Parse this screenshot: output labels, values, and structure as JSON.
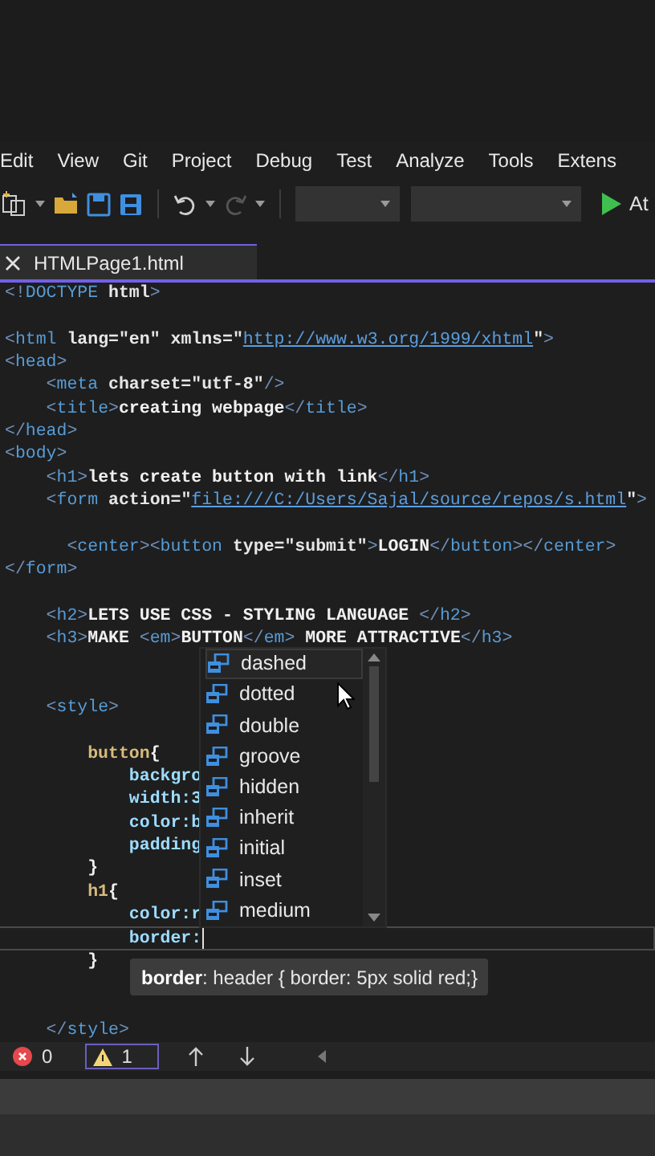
{
  "menu": [
    "Edit",
    "View",
    "Git",
    "Project",
    "Debug",
    "Test",
    "Analyze",
    "Tools",
    "Extens"
  ],
  "toolbar": {
    "run_label": "At"
  },
  "tabs": [
    {
      "label": "HTMLPage1.html",
      "selected": true
    }
  ],
  "editor": {
    "lines": [
      {
        "current": false,
        "segments": [
          {
            "kind": "punct",
            "text": "<!"
          },
          {
            "kind": "tag",
            "text": "DOCTYPE"
          },
          {
            "kind": "attr",
            "text": " html"
          },
          {
            "kind": "punct",
            "text": ">"
          }
        ]
      },
      {
        "current": false
      },
      {
        "current": false,
        "segments": [
          {
            "kind": "punct",
            "text": "<"
          },
          {
            "kind": "tag",
            "text": "html"
          },
          {
            "kind": "attr",
            "text": " lang="
          },
          {
            "kind": "value",
            "text": "\"en\""
          },
          {
            "kind": "attr",
            "text": " xmlns="
          },
          {
            "kind": "value",
            "text": "\""
          },
          {
            "kind": "url",
            "text": "http://www.w3.org/1999/xhtml"
          },
          {
            "kind": "value",
            "text": "\""
          },
          {
            "kind": "punct",
            "text": ">"
          }
        ]
      },
      {
        "current": false,
        "segments": [
          {
            "kind": "punct",
            "text": "<"
          },
          {
            "kind": "tag",
            "text": "head"
          },
          {
            "kind": "punct",
            "text": ">"
          }
        ]
      },
      {
        "current": false,
        "segments": [
          {
            "kind": "punct",
            "text": "    <"
          },
          {
            "kind": "tag",
            "text": "meta"
          },
          {
            "kind": "attr",
            "text": " charset="
          },
          {
            "kind": "value",
            "text": "\"utf-8\""
          },
          {
            "kind": "punct",
            "text": "/>"
          }
        ]
      },
      {
        "current": false,
        "segments": [
          {
            "kind": "punct",
            "text": "    <"
          },
          {
            "kind": "tag",
            "text": "title"
          },
          {
            "kind": "punct",
            "text": ">"
          },
          {
            "kind": "text",
            "text": "creating webpage"
          },
          {
            "kind": "punct",
            "text": "</"
          },
          {
            "kind": "tag",
            "text": "title"
          },
          {
            "kind": "punct",
            "text": ">"
          }
        ]
      },
      {
        "current": false,
        "segments": [
          {
            "kind": "punct",
            "text": "</"
          },
          {
            "kind": "tag",
            "text": "head"
          },
          {
            "kind": "punct",
            "text": ">"
          }
        ]
      },
      {
        "current": false,
        "segments": [
          {
            "kind": "punct",
            "text": "<"
          },
          {
            "kind": "tag",
            "text": "body"
          },
          {
            "kind": "punct",
            "text": ">"
          }
        ]
      },
      {
        "current": false,
        "segments": [
          {
            "kind": "punct",
            "text": "    <"
          },
          {
            "kind": "tag",
            "text": "h1"
          },
          {
            "kind": "punct",
            "text": ">"
          },
          {
            "kind": "text",
            "text": "lets create button with link"
          },
          {
            "kind": "punct",
            "text": "</"
          },
          {
            "kind": "tag",
            "text": "h1"
          },
          {
            "kind": "punct",
            "text": ">"
          }
        ]
      },
      {
        "current": false,
        "segments": [
          {
            "kind": "punct",
            "text": "    <"
          },
          {
            "kind": "tag",
            "text": "form"
          },
          {
            "kind": "attr",
            "text": " action="
          },
          {
            "kind": "value",
            "text": "\""
          },
          {
            "kind": "url",
            "text": "file:///C:/Users/Sajal/source/repos/s.html"
          },
          {
            "kind": "value",
            "text": "\""
          },
          {
            "kind": "punct",
            "text": ">"
          }
        ]
      },
      {
        "current": false
      },
      {
        "current": false,
        "segments": [
          {
            "kind": "punct",
            "text": "      <"
          },
          {
            "kind": "tag",
            "text": "center"
          },
          {
            "kind": "punct",
            "text": "><"
          },
          {
            "kind": "tag",
            "text": "button"
          },
          {
            "kind": "attr",
            "text": " type="
          },
          {
            "kind": "value",
            "text": "\"submit\""
          },
          {
            "kind": "punct",
            "text": ">"
          },
          {
            "kind": "text",
            "text": "LOGIN"
          },
          {
            "kind": "punct",
            "text": "</"
          },
          {
            "kind": "tag",
            "text": "button"
          },
          {
            "kind": "punct",
            "text": "></"
          },
          {
            "kind": "tag",
            "text": "center"
          },
          {
            "kind": "punct",
            "text": ">"
          }
        ]
      },
      {
        "current": false,
        "segments": [
          {
            "kind": "punct",
            "text": "</"
          },
          {
            "kind": "tag",
            "text": "form"
          },
          {
            "kind": "punct",
            "text": ">"
          }
        ]
      },
      {
        "current": false
      },
      {
        "current": false,
        "segments": [
          {
            "kind": "punct",
            "text": "    <"
          },
          {
            "kind": "tag",
            "text": "h2"
          },
          {
            "kind": "punct",
            "text": ">"
          },
          {
            "kind": "text",
            "text": "LETS USE CSS - STYLING LANGUAGE "
          },
          {
            "kind": "punct",
            "text": "</"
          },
          {
            "kind": "tag",
            "text": "h2"
          },
          {
            "kind": "punct",
            "text": ">"
          }
        ]
      },
      {
        "current": false,
        "segments": [
          {
            "kind": "punct",
            "text": "    <"
          },
          {
            "kind": "tag",
            "text": "h3"
          },
          {
            "kind": "punct",
            "text": ">"
          },
          {
            "kind": "text",
            "text": "MAKE "
          },
          {
            "kind": "punct",
            "text": "<"
          },
          {
            "kind": "tag",
            "text": "em"
          },
          {
            "kind": "punct",
            "text": ">"
          },
          {
            "kind": "text",
            "text": "BUTTON"
          },
          {
            "kind": "punct",
            "text": "</"
          },
          {
            "kind": "tag",
            "text": "em"
          },
          {
            "kind": "punct",
            "text": ">"
          },
          {
            "kind": "text",
            "text": " MORE ATTRACTIVE"
          },
          {
            "kind": "punct",
            "text": "</"
          },
          {
            "kind": "tag",
            "text": "h3"
          },
          {
            "kind": "punct",
            "text": ">"
          }
        ]
      },
      {
        "current": false
      },
      {
        "current": false
      },
      {
        "current": false,
        "segments": [
          {
            "kind": "punct",
            "text": "    <"
          },
          {
            "kind": "tag",
            "text": "style"
          },
          {
            "kind": "punct",
            "text": ">"
          }
        ]
      },
      {
        "current": false
      },
      {
        "current": false,
        "segments": [
          {
            "kind": "selector",
            "text": "        button"
          },
          {
            "kind": "text",
            "text": "{"
          }
        ]
      },
      {
        "current": false,
        "segments": [
          {
            "kind": "property",
            "text": "            backgro"
          }
        ]
      },
      {
        "current": false,
        "segments": [
          {
            "kind": "property",
            "text": "            width:3"
          }
        ]
      },
      {
        "current": false,
        "segments": [
          {
            "kind": "property",
            "text": "            color:b"
          }
        ]
      },
      {
        "current": false,
        "segments": [
          {
            "kind": "property",
            "text": "            padding"
          }
        ]
      },
      {
        "current": false,
        "segments": [
          {
            "kind": "text",
            "text": "        }"
          }
        ]
      },
      {
        "current": false,
        "segments": [
          {
            "kind": "selector",
            "text": "        h1"
          },
          {
            "kind": "text",
            "text": "{"
          }
        ]
      },
      {
        "current": false,
        "segments": [
          {
            "kind": "property",
            "text": "            color:r"
          }
        ]
      },
      {
        "current": true,
        "segments": [
          {
            "kind": "property",
            "text": "            border:"
          }
        ]
      },
      {
        "current": false,
        "segments": [
          {
            "kind": "text",
            "text": "        }"
          }
        ]
      },
      {
        "current": false
      },
      {
        "current": false
      },
      {
        "current": false,
        "segments": [
          {
            "kind": "punct",
            "text": "    </"
          },
          {
            "kind": "tag",
            "text": "style"
          },
          {
            "kind": "punct",
            "text": ">"
          }
        ]
      }
    ]
  },
  "completion": {
    "items": [
      {
        "label": "dashed",
        "selected": true
      },
      {
        "label": "dotted",
        "selected": false
      },
      {
        "label": "double",
        "selected": false
      },
      {
        "label": "groove",
        "selected": false
      },
      {
        "label": "hidden",
        "selected": false
      },
      {
        "label": "inherit",
        "selected": false
      },
      {
        "label": "initial",
        "selected": false
      },
      {
        "label": "inset",
        "selected": false
      },
      {
        "label": "medium",
        "selected": false
      }
    ]
  },
  "tooltip": "**border**: header { border: 5px solid red;}",
  "status_bar": {
    "errors": "0",
    "warnings": "1"
  }
}
